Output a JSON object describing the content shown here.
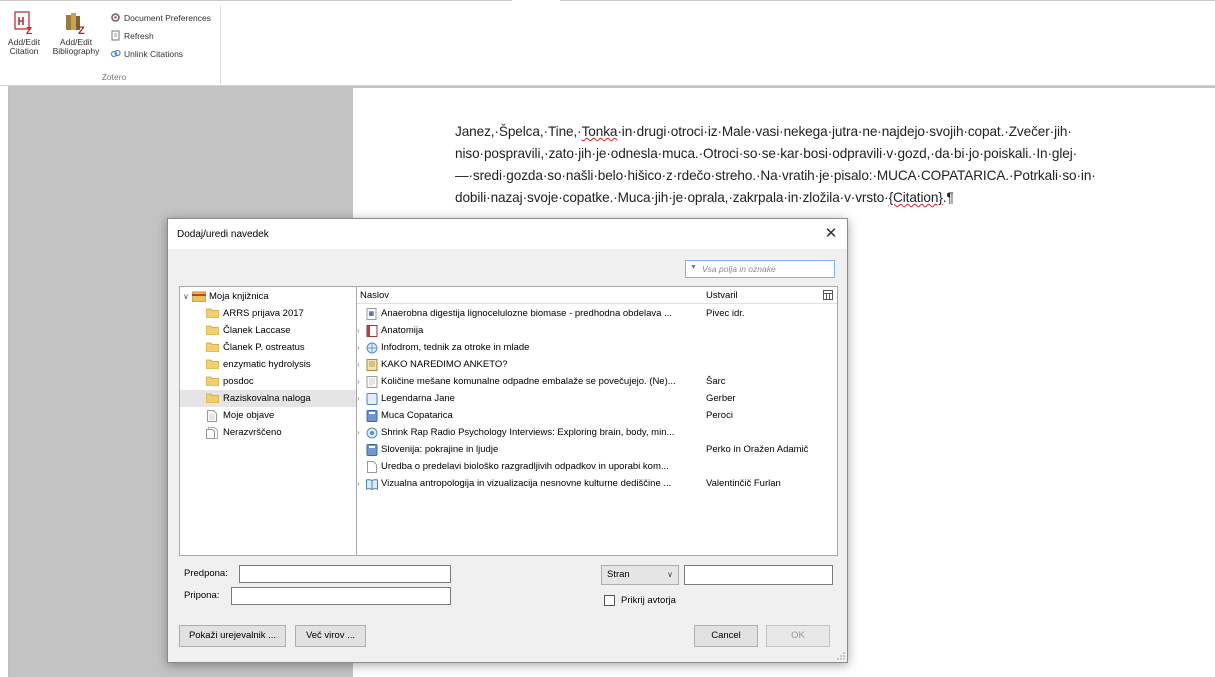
{
  "ribbon": {
    "add_edit_citation": "Add/Edit Citation",
    "add_edit_bibliography": "Add/Edit Bibliography",
    "document_preferences": "Document Preferences",
    "refresh": "Refresh",
    "unlink_citations": "Unlink Citations",
    "group_label": "Zotero"
  },
  "document": {
    "line1_a": "Janez,·Špelca,·Tine,·",
    "line1_b": "Tonka",
    "line1_c": "·in·drugi·otroci·iz·Male·vasi·nekega·jutra·ne·najdejo·svojih·copat.·Zvečer·jih·",
    "line2": "niso·pospravili,·zato·jih·je·odnesla·muca.·Otroci·so·se·kar·bosi·odpravili·v·gozd,·da·bi·jo·poiskali.·In·glej·",
    "line3": "—·sredi·gozda·so·našli·belo·hišico·z·rdečo·streho.·Na·vratih·je·pisalo:·MUCA·COPATARICA.·Potrkali·so·in·",
    "line4_a": "dobili·nazaj·svoje·copatke.·Muca·jih·je·oprala,·zakrpala·in·zložila·v·vrsto·",
    "line4_b": "{Citation}",
    "line4_c": ".¶"
  },
  "dialog": {
    "title": "Dodaj/uredi navedek",
    "search_placeholder": "Vsa polja in oznake",
    "collections": [
      {
        "label": "Moja knjižnica"
      },
      {
        "label": "ARRS prijava 2017"
      },
      {
        "label": "Članek Laccase"
      },
      {
        "label": "Članek P. ostreatus"
      },
      {
        "label": "enzymatic hydrolysis"
      },
      {
        "label": "posdoc"
      },
      {
        "label": "Raziskovalna naloga"
      },
      {
        "label": "Moje objave"
      },
      {
        "label": "Nerazvrščeno"
      }
    ],
    "columns": {
      "title": "Naslov",
      "creator": "Ustvaril"
    },
    "items": [
      {
        "title": "Anaerobna digestija lignocelulozne biomase - predhodna obdelava ...",
        "creator": "Pivec idr."
      },
      {
        "title": "Anatomija",
        "creator": ""
      },
      {
        "title": "Infodrom, tednik za otroke in mlade",
        "creator": ""
      },
      {
        "title": "KAKO NAREDIMO ANKETO?",
        "creator": ""
      },
      {
        "title": "Količine mešane komunalne odpadne embalaže se povečujejo. (Ne)...",
        "creator": "Šarc"
      },
      {
        "title": "Legendarna Jane",
        "creator": "Gerber"
      },
      {
        "title": "Muca Copatarica",
        "creator": "Peroci"
      },
      {
        "title": "Shrink Rap Radio Psychology Interviews: Exploring brain, body, min...",
        "creator": ""
      },
      {
        "title": "Slovenija: pokrajine in ljudje",
        "creator": "Perko in Oražen Adamič"
      },
      {
        "title": "Uredba o predelavi biološko razgradljivih odpadkov in uporabi kom...",
        "creator": ""
      },
      {
        "title": "Vizualna antropologija in vizualizacija nesnovne kulturne dediščine ...",
        "creator": "Valentinčič Furlan"
      }
    ],
    "prefix_label": "Predpona:",
    "suffix_label": "Pripona:",
    "prefix_value": "",
    "suffix_value": "",
    "locator_select": "Stran",
    "locator_value": "",
    "suppress_author_label": "Prikrij avtorja",
    "show_editor_button": "Pokaži urejevalnik ...",
    "multiple_sources_button": "Več virov ...",
    "cancel_button": "Cancel",
    "ok_button": "OK"
  },
  "colors": {
    "accent_blue": "#7eb4ea",
    "folder_yellow": "#e8c25a",
    "selection_gray": "#e5e5e5",
    "spell_red": "#d22222"
  }
}
